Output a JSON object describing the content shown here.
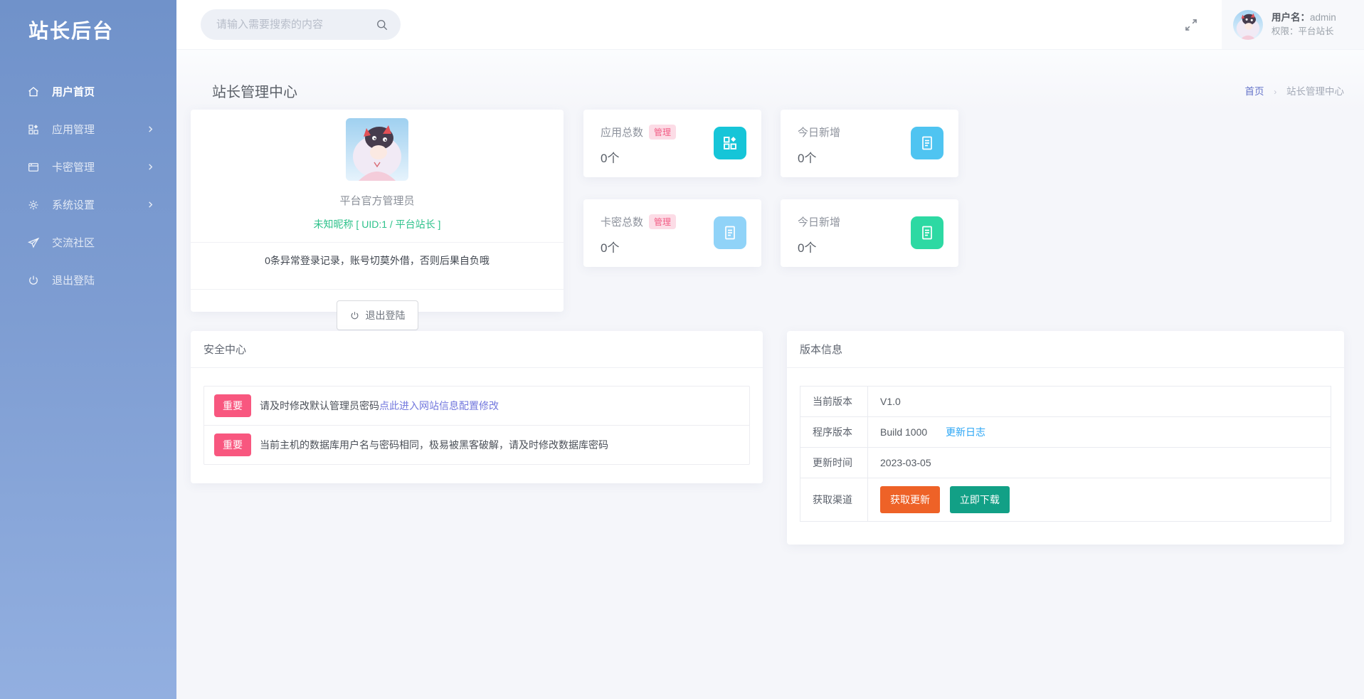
{
  "sidebar": {
    "logo": "站长后台",
    "items": [
      {
        "label": "用户首页",
        "icon": "home-icon",
        "active": true,
        "chevron": false
      },
      {
        "label": "应用管理",
        "icon": "apps-icon",
        "active": false,
        "chevron": true
      },
      {
        "label": "卡密管理",
        "icon": "card-icon",
        "active": false,
        "chevron": true
      },
      {
        "label": "系统设置",
        "icon": "gear-icon",
        "active": false,
        "chevron": true
      },
      {
        "label": "交流社区",
        "icon": "send-icon",
        "active": false,
        "chevron": false
      },
      {
        "label": "退出登陆",
        "icon": "power-icon",
        "active": false,
        "chevron": false
      }
    ]
  },
  "topbar": {
    "search_placeholder": "请输入需要搜索的内容",
    "user": {
      "name_label": "用户名：",
      "name": "admin",
      "role_label": "权限：",
      "role": "平台站长"
    }
  },
  "page": {
    "title": "站长管理中心",
    "breadcrumb": {
      "home": "首页",
      "separator": "›",
      "current": "站长管理中心"
    }
  },
  "profile": {
    "title": "平台官方管理员",
    "identity": "未知昵称 [ UID:1 / 平台站长 ]",
    "notice": "0条异常登录记录，账号切莫外借，否则后果自负哦",
    "logout_label": "退出登陆"
  },
  "stats": [
    {
      "label": "应用总数",
      "badge": "管理",
      "value": "0个",
      "icon": "apps-icon",
      "icon_color": "#16c5d8"
    },
    {
      "label": "今日新增",
      "value": "0个",
      "icon": "doc-icon",
      "icon_color": "#4fc4f1"
    },
    {
      "label": "卡密总数",
      "badge": "管理",
      "value": "0个",
      "icon": "doc-icon",
      "icon_color": "#90d3f8"
    },
    {
      "label": "今日新增",
      "value": "0个",
      "icon": "doc-icon",
      "icon_color": "#2dd9a3"
    }
  ],
  "security": {
    "title": "安全中心",
    "alerts": [
      {
        "badge": "重要",
        "text": "请及时修改默认管理员密码 ",
        "link": "点此进入网站信息配置修改"
      },
      {
        "badge": "重要",
        "text": "当前主机的数据库用户名与密码相同，极易被黑客破解，请及时修改数据库密码"
      }
    ]
  },
  "version": {
    "title": "版本信息",
    "rows": [
      {
        "label": "当前版本",
        "value": "V1.0"
      },
      {
        "label": "程序版本",
        "value": "Build 1000",
        "link": "更新日志"
      },
      {
        "label": "更新时间",
        "value": "2023-03-05"
      },
      {
        "label": "获取渠道",
        "buttons": [
          {
            "label": "获取更新",
            "color": "#ee6227"
          },
          {
            "label": "立即下载",
            "color": "#12a086"
          }
        ]
      }
    ]
  },
  "colors": {
    "sidebar_top": "#7092ca",
    "sidebar_bottom": "#92afe0",
    "badge_pink_bg": "#fcdce6",
    "badge_pink_text": "#f25d85",
    "important_badge": "#f8577f",
    "identity_green": "#2ec28b",
    "link_purple": "#7277dd",
    "link_blue": "#2ba6f5",
    "breadcrumb_home": "#6574c9"
  }
}
